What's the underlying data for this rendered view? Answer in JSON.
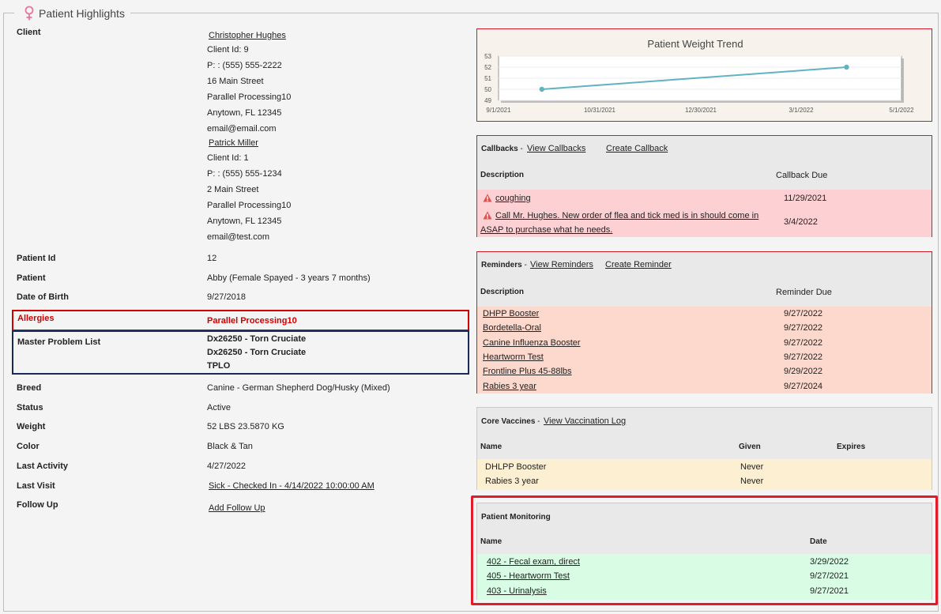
{
  "header": {
    "title": "Patient Highlights"
  },
  "client": {
    "label": "Client",
    "primary": {
      "name": "Christopher Hughes",
      "client_id": "Client Id: 9",
      "phone": "P: : (555) 555-2222",
      "street": "16 Main Street",
      "line2": "Parallel Processing10",
      "city": "Anytown, FL 12345",
      "email": "email@email.com"
    },
    "secondary": {
      "name": "Patrick Miller",
      "client_id": "Client Id: 1",
      "phone": "P: : (555) 555-1234",
      "street": "2 Main Street",
      "line2": "Parallel Processing10",
      "city": "Anytown, FL 12345",
      "email": "email@test.com"
    }
  },
  "details": {
    "patient_id": {
      "label": "Patient Id",
      "value": "12"
    },
    "patient": {
      "label": "Patient",
      "value": "Abby (Female Spayed - 3 years 7 months)"
    },
    "dob": {
      "label": "Date of Birth",
      "value": "9/27/2018"
    },
    "allergies": {
      "label": "Allergies",
      "value": "Parallel Processing10"
    },
    "mpl": {
      "label": "Master Problem List",
      "items": [
        "Dx26250 - Torn Cruciate",
        "Dx26250 - Torn Cruciate",
        "TPLO"
      ]
    },
    "breed": {
      "label": "Breed",
      "value": "Canine - German Shepherd Dog/Husky (Mixed)"
    },
    "status": {
      "label": "Status",
      "value": "Active"
    },
    "weight": {
      "label": "Weight",
      "value": "52 LBS 23.5870 KG"
    },
    "color": {
      "label": "Color",
      "value": "Black & Tan"
    },
    "last_activity": {
      "label": "Last Activity",
      "value": "4/27/2022"
    },
    "last_visit": {
      "label": "Last Visit",
      "value": "Sick - Checked In - 4/14/2022 10:00:00 AM"
    },
    "follow_up": {
      "label": "Follow Up",
      "value": "Add Follow Up"
    }
  },
  "chart_data": {
    "type": "line",
    "title": "Patient Weight Trend",
    "x": [
      "2021-09-27",
      "2022-03-29"
    ],
    "y": [
      50,
      52
    ],
    "xlim": [
      "2021-09-01",
      "2022-05-01"
    ],
    "ylim": [
      49,
      53
    ],
    "xticks": [
      "9/1/2021",
      "10/31/2021",
      "12/30/2021",
      "3/1/2022",
      "5/1/2022"
    ],
    "yticks": [
      "49",
      "50",
      "51",
      "52",
      "53"
    ],
    "color": "#5fb3c2",
    "grid": true
  },
  "callbacks": {
    "title": "Callbacks",
    "view_link": "View Callbacks",
    "create_link": "Create Callback",
    "col_desc": "Description",
    "col_due": "Callback Due",
    "rows": [
      {
        "desc": "coughing",
        "due": "11/29/2021"
      },
      {
        "desc_line1": "Call Mr. Hughes. New order of flea and tick med is in should come in",
        "desc_line2": "ASAP to purchase what he needs.",
        "due": "3/4/2022"
      }
    ],
    "bg": "#fdd0d4"
  },
  "reminders": {
    "title": "Reminders",
    "view_link": "View Reminders",
    "create_link": "Create Reminder",
    "col_desc": "Description",
    "col_due": "Reminder Due",
    "rows": [
      {
        "desc": "DHPP Booster",
        "due": "9/27/2022"
      },
      {
        "desc": "Bordetella-Oral",
        "due": "9/27/2022"
      },
      {
        "desc": "Canine Influenza Booster",
        "due": "9/27/2022"
      },
      {
        "desc": "Heartworm Test",
        "due": "9/27/2022"
      },
      {
        "desc": "Frontline Plus 45-88lbs",
        "due": "9/29/2022"
      },
      {
        "desc": "Rabies 3 year",
        "due": "9/27/2024"
      }
    ],
    "bg": "#fcd9cc"
  },
  "vaccines": {
    "title": "Core Vaccines",
    "view_link": "View Vaccination Log",
    "col_name": "Name",
    "col_given": "Given",
    "col_expires": "Expires",
    "rows": [
      {
        "name": "DHLPP Booster",
        "given": "Never",
        "expires": ""
      },
      {
        "name": "Rabies 3 year",
        "given": "Never",
        "expires": ""
      }
    ],
    "bg": "#fdf0d2"
  },
  "monitoring": {
    "title": "Patient Monitoring",
    "col_name": "Name",
    "col_date": "Date",
    "rows": [
      {
        "name": "402 - Fecal exam, direct",
        "date": "3/29/2022"
      },
      {
        "name": "405 - Heartworm Test",
        "date": "9/27/2021"
      },
      {
        "name": "403 - Urinalysis",
        "date": "9/27/2021"
      }
    ],
    "bg": "#d8fde4"
  }
}
